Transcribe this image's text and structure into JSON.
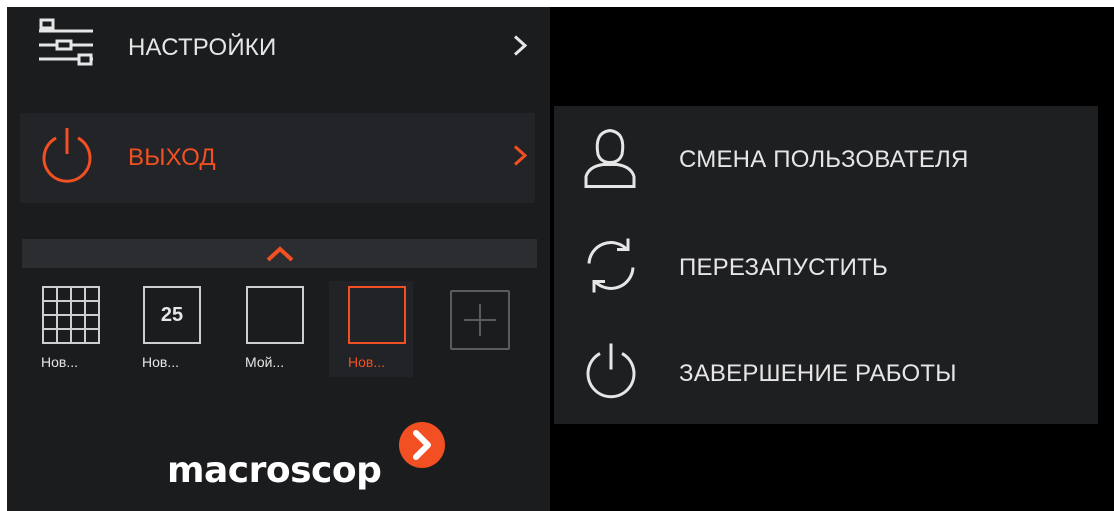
{
  "colors": {
    "accent": "#f25022",
    "panel": "#1b1c1e",
    "text": "#e6e6e6"
  },
  "menu": {
    "settings": {
      "label": "НАСТРОЙКИ",
      "icon": "sliders-icon"
    },
    "exit": {
      "label": "ВЫХОД",
      "icon": "power-icon"
    }
  },
  "layouts": [
    {
      "name": "Нов...",
      "thumb": "grid-icon"
    },
    {
      "name": "Нов...",
      "thumb": "25"
    },
    {
      "name": "Мой...",
      "thumb": "empty"
    },
    {
      "name": "Нов...",
      "thumb": "empty",
      "active": true
    }
  ],
  "submenu": {
    "items": [
      {
        "label": "СМЕНА ПОЛЬЗОВАТЕЛЯ",
        "icon": "user-icon"
      },
      {
        "label": "ПЕРЕЗАПУСТИТЬ",
        "icon": "restart-icon"
      },
      {
        "label": "ЗАВЕРШЕНИЕ РАБОТЫ",
        "icon": "power-icon"
      }
    ]
  },
  "logo": {
    "text": "macroscop"
  }
}
